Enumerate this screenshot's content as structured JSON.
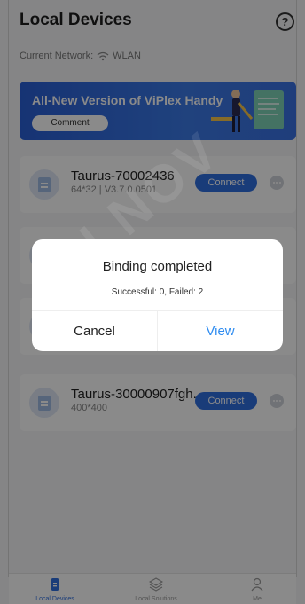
{
  "header": {
    "title": "Local Devices",
    "help_icon": "question-circle-icon"
  },
  "network": {
    "label": "Current Network:",
    "value": "WLAN",
    "icon": "wifi-icon"
  },
  "banner": {
    "text": "All-New Version of ViPlex Handy",
    "button_label": "Comment"
  },
  "devices": [
    {
      "name": "Taurus-70002436",
      "detail": "64*32 | V3.7.0.0501",
      "action": "Connect"
    },
    {
      "name": "",
      "detail": "",
      "action": ""
    },
    {
      "name": "",
      "detail": "",
      "action": ""
    },
    {
      "name": "Taurus-30000907fgh...",
      "detail": "400*400",
      "action": "Connect"
    }
  ],
  "dialog": {
    "title": "Binding completed",
    "message": "Successful: 0, Failed: 2",
    "cancel_label": "Cancel",
    "view_label": "View"
  },
  "tabbar": {
    "tabs": [
      {
        "label": "Local Devices",
        "icon": "device-icon",
        "active": true
      },
      {
        "label": "Local Solutions",
        "icon": "layers-icon",
        "active": false
      },
      {
        "label": "Me",
        "icon": "person-icon",
        "active": false
      }
    ]
  },
  "watermark": "AN NOV",
  "colors": {
    "accent": "#2f6fe0",
    "dialog_action": "#2f8cf0",
    "banner": "#3a72e4"
  }
}
